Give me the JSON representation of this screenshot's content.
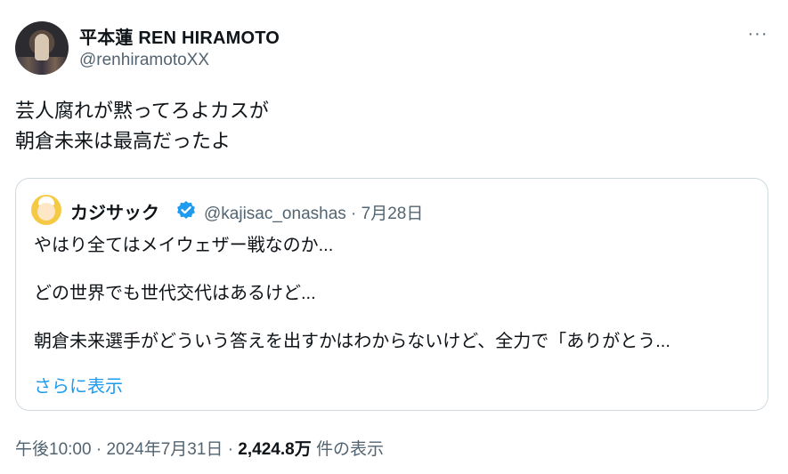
{
  "author": {
    "name": "平本蓮 REN HIRAMOTO",
    "handle": "@renhiramotoXX"
  },
  "more_label": "···",
  "tweet": {
    "lines": [
      "芸人腐れが黙ってろよカスが",
      "朝倉未来は最高だったよ"
    ]
  },
  "quoted": {
    "name": "カジサック",
    "handle": "@kajisac_onashas",
    "separator": "·",
    "date": "7月28日",
    "lines": [
      "やはり全てはメイウェザー戦なのか...",
      "どの世界でも世代交代はあるけど...",
      "朝倉未来選手がどういう答えを出すかはわからないけど、全力で「ありがとう..."
    ],
    "show_more": "さらに表示"
  },
  "footer": {
    "time": "午後10:00",
    "sep1": "·",
    "date": "2024年7月31日",
    "sep2": "·",
    "views": "2,424.8万",
    "views_suffix": "件の表示"
  },
  "colors": {
    "text": "#0f1419",
    "secondary": "#536471",
    "link": "#1d9bf0",
    "border": "#cfd9de"
  }
}
